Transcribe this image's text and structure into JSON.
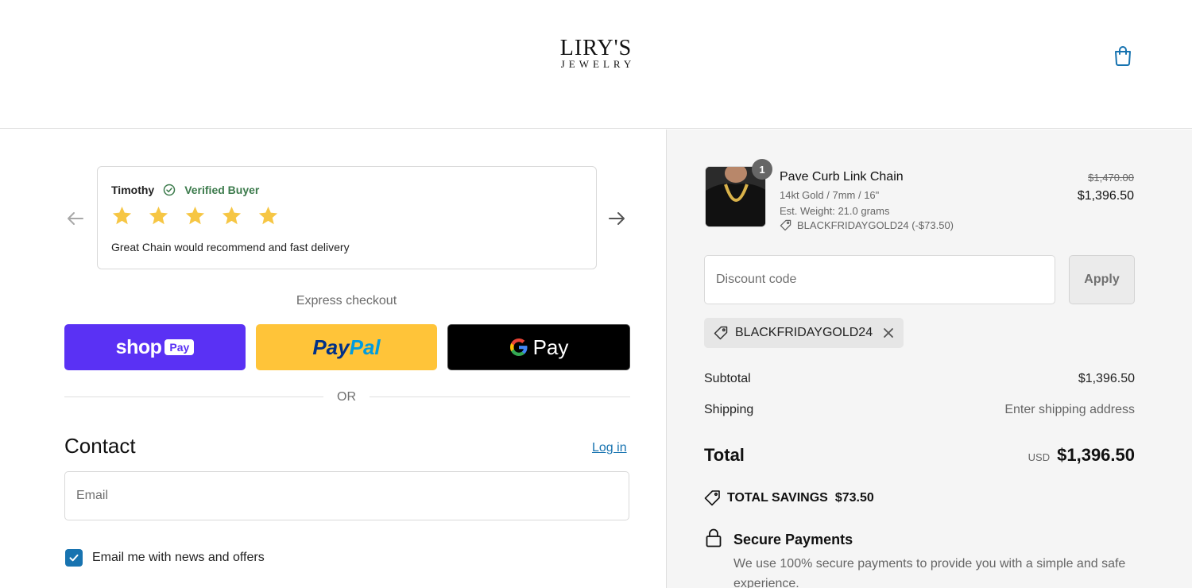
{
  "brand": {
    "name_line1": "LIRY'S",
    "name_line2": "JEWELRY"
  },
  "icons": {
    "cart": "shopping-bag-icon",
    "prev": "arrow-left-icon",
    "next": "arrow-right-icon",
    "verified": "check-circle-icon",
    "star": "star-icon",
    "tag": "tag-icon",
    "close": "close-icon",
    "lock": "lock-icon",
    "checkbox": "checkmark-icon"
  },
  "colors": {
    "accent": "#1773b0",
    "shop_pay": "#5a31f4",
    "paypal": "#ffc439",
    "gpay": "#000000",
    "star": "#f6c644",
    "verified": "#3b7a4b"
  },
  "review": {
    "name": "Timothy",
    "verified_label": "Verified Buyer",
    "rating": 5,
    "text": "Great Chain would recommend and fast delivery"
  },
  "express": {
    "label": "Express checkout",
    "shop_word": "shop",
    "shop_badge": "Pay",
    "paypal_a": "Pay",
    "paypal_b": "Pal",
    "gpay_word": "Pay"
  },
  "divider": {
    "or": "OR"
  },
  "contact": {
    "title": "Contact",
    "login_label": "Log in",
    "email_placeholder": "Email",
    "newsletter_label": "Email me with news and offers",
    "newsletter_checked": true
  },
  "cart": {
    "item": {
      "quantity": "1",
      "name": "Pave Curb Link Chain",
      "variant": "14kt Gold / 7mm / 16\"",
      "weight": "Est. Weight: 21.0 grams",
      "discount": "BLACKFRIDAYGOLD24 (-$73.50)",
      "price_original": "$1,470.00",
      "price": "$1,396.50"
    },
    "discount_placeholder": "Discount code",
    "apply_label": "Apply",
    "applied_code": "BLACKFRIDAYGOLD24"
  },
  "summary": {
    "subtotal_label": "Subtotal",
    "subtotal_value": "$1,396.50",
    "shipping_label": "Shipping",
    "shipping_value": "Enter shipping address",
    "total_label": "Total",
    "currency": "USD",
    "total_value": "$1,396.50",
    "savings_label": "TOTAL SAVINGS",
    "savings_value": "$73.50"
  },
  "secure": {
    "title": "Secure Payments",
    "text": "We use 100% secure payments to provide you with a simple and safe experience."
  }
}
